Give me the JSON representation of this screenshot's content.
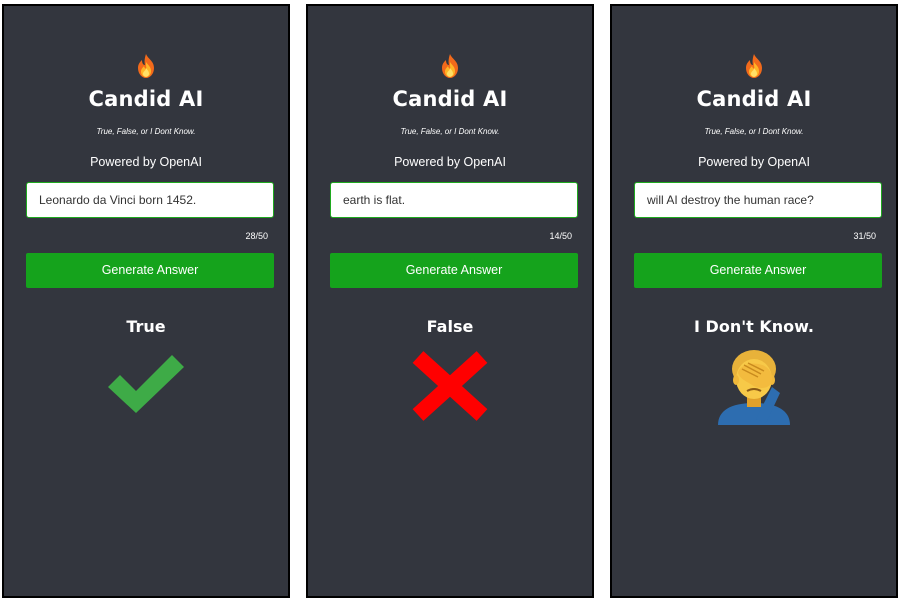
{
  "panels": [
    {
      "title": "Candid AI",
      "tagline": "True, False, or I Dont Know.",
      "powered_by": "Powered by OpenAI",
      "input": {
        "value": "Leonardo da Vinci born 1452."
      },
      "char_count": "28/50",
      "button_label": "Generate Answer",
      "answer": "True",
      "answer_icon": "checkmark-icon"
    },
    {
      "title": "Candid AI",
      "tagline": "True, False, or I Dont Know.",
      "powered_by": "Powered by OpenAI",
      "input": {
        "value": "earth is flat."
      },
      "char_count": "14/50",
      "button_label": "Generate Answer",
      "answer": "False",
      "answer_icon": "cross-icon"
    },
    {
      "title": "Candid AI",
      "tagline": "True, False, or I Dont Know.",
      "powered_by": "Powered by OpenAI",
      "input": {
        "value": "will AI destroy the human race?"
      },
      "char_count": "31/50",
      "button_label": "Generate Answer",
      "answer": "I Don't Know.",
      "answer_icon": "facepalm-icon"
    }
  ],
  "colors": {
    "panel_background": "#33363e",
    "button": "#15a31c",
    "input_border": "#1fa91f",
    "check": "#3eab47",
    "cross": "#ff0000",
    "flame": "#f7931e"
  }
}
